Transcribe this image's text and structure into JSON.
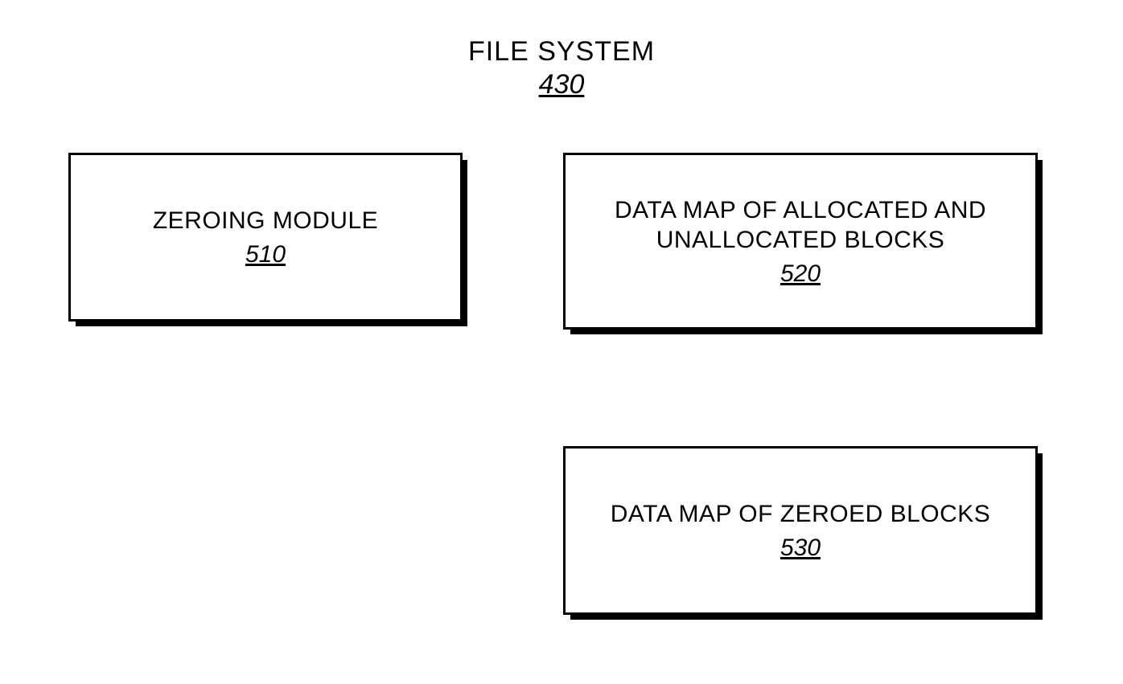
{
  "title": {
    "label": "FILE SYSTEM",
    "number": "430"
  },
  "boxes": {
    "zeroing": {
      "label": "ZEROING MODULE",
      "number": "510"
    },
    "allocmap": {
      "label": "DATA MAP OF ALLOCATED AND UNALLOCATED BLOCKS",
      "number": "520"
    },
    "zeromap": {
      "label": "DATA MAP OF ZEROED BLOCKS",
      "number": "530"
    }
  }
}
